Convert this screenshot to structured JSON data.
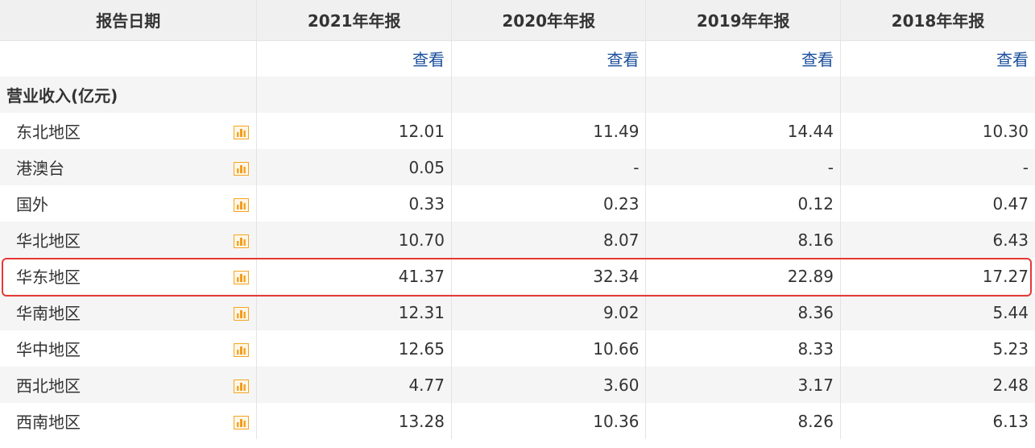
{
  "header": {
    "label": "报告日期",
    "periods": [
      "2021年年报",
      "2020年年报",
      "2019年年报",
      "2018年年报"
    ]
  },
  "view_row": {
    "links": [
      "查看",
      "查看",
      "查看",
      "查看"
    ]
  },
  "section": {
    "title": "营业收入(亿元)"
  },
  "rows": [
    {
      "region": "东北地区",
      "values": [
        "12.01",
        "11.49",
        "14.44",
        "10.30"
      ],
      "icon": "bar-chart-icon"
    },
    {
      "region": "港澳台",
      "values": [
        "0.05",
        "-",
        "-",
        "-"
      ],
      "icon": "bar-chart-icon"
    },
    {
      "region": "国外",
      "values": [
        "0.33",
        "0.23",
        "0.12",
        "0.47"
      ],
      "icon": "bar-chart-icon"
    },
    {
      "region": "华北地区",
      "values": [
        "10.70",
        "8.07",
        "8.16",
        "6.43"
      ],
      "icon": "bar-chart-icon"
    },
    {
      "region": "华东地区",
      "values": [
        "41.37",
        "32.34",
        "22.89",
        "17.27"
      ],
      "icon": "bar-chart-icon",
      "highlighted": true
    },
    {
      "region": "华南地区",
      "values": [
        "12.31",
        "9.02",
        "8.36",
        "5.44"
      ],
      "icon": "bar-chart-icon"
    },
    {
      "region": "华中地区",
      "values": [
        "12.65",
        "10.66",
        "8.33",
        "5.23"
      ],
      "icon": "bar-chart-icon"
    },
    {
      "region": "西北地区",
      "values": [
        "4.77",
        "3.60",
        "3.17",
        "2.48"
      ],
      "icon": "bar-chart-icon"
    },
    {
      "region": "西南地区",
      "values": [
        "13.28",
        "10.36",
        "8.26",
        "6.13"
      ],
      "icon": "bar-chart-icon"
    }
  ],
  "colors": {
    "link": "#1a4f9c",
    "highlight_border": "#e53935",
    "icon_orange": "#f5a623",
    "header_bg": "#f0f0f0",
    "stripe_bg": "#f5f5f5"
  }
}
